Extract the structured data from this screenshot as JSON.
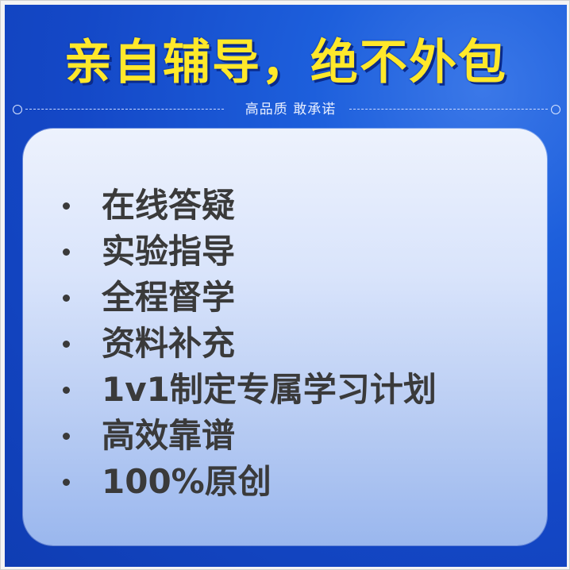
{
  "headline": "亲自辅导，绝不外包",
  "tagline": "高品质 敢承诺",
  "features": [
    "在线答疑",
    "实验指导",
    "全程督学",
    "资料补充",
    "1v1制定专属学习计划",
    "高效靠谱",
    "100%原创"
  ],
  "colors": {
    "background_blue": "#1448c7",
    "headline_yellow": "#ffe82a",
    "card_top": "#edf2fd",
    "card_bottom": "#9ab7ee",
    "text_dark": "#3a3a3a"
  }
}
